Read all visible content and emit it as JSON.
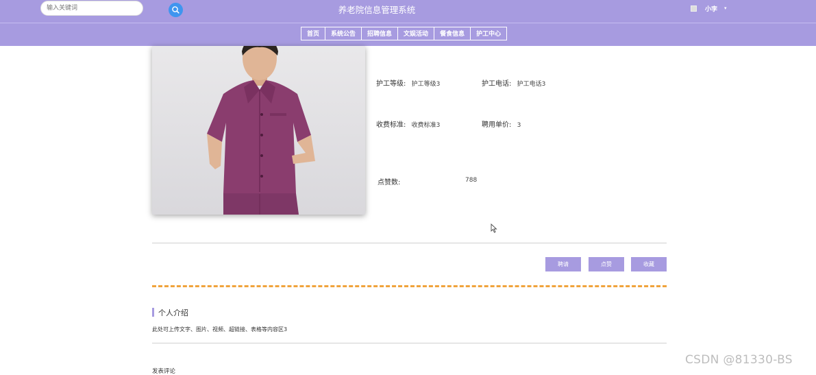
{
  "header": {
    "search_placeholder": "输入关键词",
    "site_title": "养老院信息管理系统",
    "username": "小李"
  },
  "nav": {
    "items": [
      "首页",
      "系统公告",
      "招聘信息",
      "文娱活动",
      "餐食信息",
      "护工中心"
    ]
  },
  "detail": {
    "grade_label": "护工等级:",
    "grade_value": "护工等级3",
    "phone_label": "护工电话:",
    "phone_value": "护工电话3",
    "fee_label": "收费标准:",
    "fee_value": "收费标准3",
    "price_label": "聘用单价:",
    "price_value": "3",
    "likes_label": "点赞数:",
    "likes_value": "788"
  },
  "actions": {
    "hire": "聘请",
    "like": "点赞",
    "favorite": "收藏"
  },
  "intro": {
    "title": "个人介绍",
    "content": "此处可上传文字、图片、视频、超链接、表格等内容区3"
  },
  "comments": {
    "label": "发表评论"
  },
  "watermark": "CSDN @81330-BS",
  "colors": {
    "primary": "#a79be0",
    "search_button": "#3f95ef",
    "dashed_divider": "#f0a33c",
    "uniform": "#8a3d6e"
  },
  "icons": {
    "search": "search-icon",
    "avatar": "avatar-image",
    "caret": "chevron-down-icon"
  }
}
